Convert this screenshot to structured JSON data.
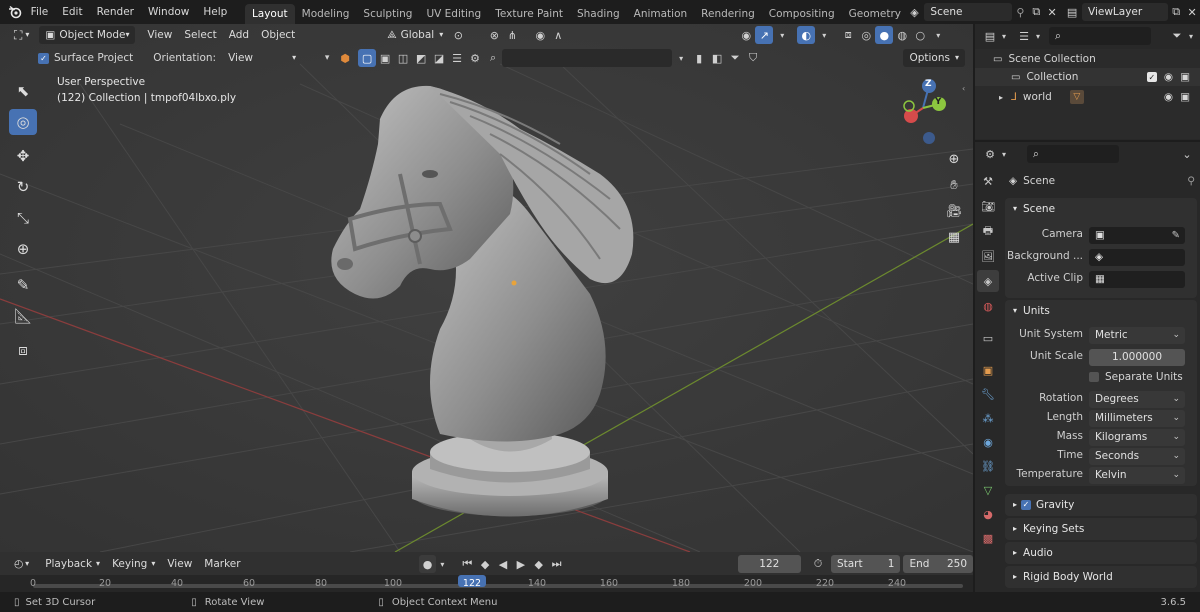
{
  "topbar": {
    "menus": [
      "File",
      "Edit",
      "Render",
      "Window",
      "Help"
    ],
    "workspace_tabs": [
      "Layout",
      "Modeling",
      "Sculpting",
      "UV Editing",
      "Texture Paint",
      "Shading",
      "Animation",
      "Rendering",
      "Compositing",
      "Geometry Noc"
    ],
    "active_tab": "Layout",
    "scene_name": "Scene",
    "view_layer": "ViewLayer"
  },
  "viewport": {
    "mode": "Object Mode",
    "menus": [
      "View",
      "Select",
      "Add",
      "Object"
    ],
    "transform_orientation": "Global",
    "surface_project_label": "Surface Project",
    "orientation_label": "Orientation:",
    "orientation_value": "View",
    "options_label": "Options",
    "overlay_title": "User Perspective",
    "overlay_subtitle": "(122) Collection | tmpof04lbxo.ply",
    "gizmo_z": "Z",
    "gizmo_y": "Y"
  },
  "outliner": {
    "root": "Scene Collection",
    "collection": "Collection",
    "object": "world"
  },
  "properties": {
    "context_title": "Scene",
    "scene_panel": {
      "title": "Scene",
      "camera_label": "Camera",
      "background_label": "Background ...",
      "active_clip_label": "Active Clip"
    },
    "units_panel": {
      "title": "Units",
      "rows": [
        {
          "label": "Unit System",
          "value": "Metric"
        },
        {
          "label": "Unit Scale",
          "value": "1.000000"
        }
      ],
      "separate_units_label": "Separate Units",
      "rows2": [
        {
          "label": "Rotation",
          "value": "Degrees"
        },
        {
          "label": "Length",
          "value": "Millimeters"
        },
        {
          "label": "Mass",
          "value": "Kilograms"
        },
        {
          "label": "Time",
          "value": "Seconds"
        },
        {
          "label": "Temperature",
          "value": "Kelvin"
        }
      ]
    },
    "collapsed_panels": [
      "Gravity",
      "Keying Sets",
      "Audio",
      "Rigid Body World"
    ]
  },
  "timeline": {
    "menus": [
      "Playback",
      "Keying",
      "View",
      "Marker"
    ],
    "current_frame": "122",
    "start_label": "Start",
    "start_value": "1",
    "end_label": "End",
    "end_value": "250",
    "ticks": [
      "0",
      "20",
      "40",
      "60",
      "80",
      "100",
      "122",
      "140",
      "160",
      "180",
      "200",
      "220",
      "240"
    ]
  },
  "statusbar": {
    "items": [
      "Set 3D Cursor",
      "Rotate View",
      "Object Context Menu"
    ],
    "version": "3.6.5"
  },
  "colors": {
    "accent": "#4772b3",
    "viewport_bg": "#3a3a3a",
    "panel_bg": "#282828",
    "playhead": "#4772b3"
  }
}
